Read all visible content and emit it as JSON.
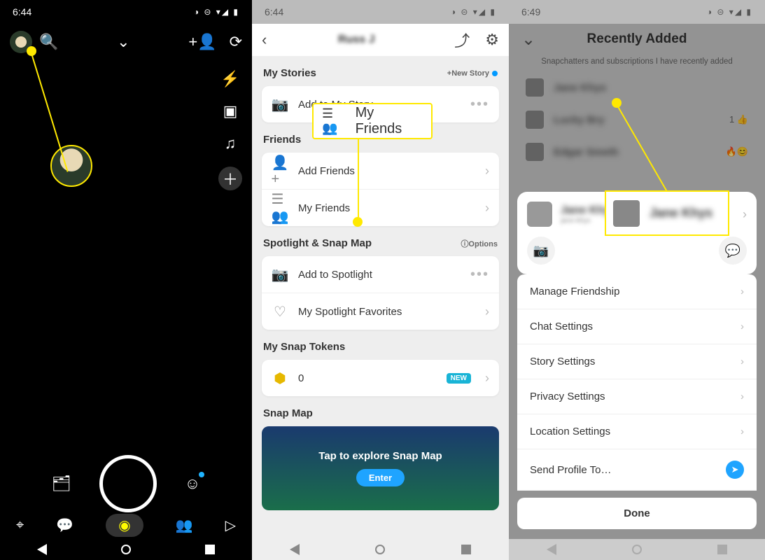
{
  "status": {
    "time1": "6:44",
    "time2": "6:44",
    "time3": "6:49",
    "icons": "◑ ⊝ ▾◢ ▮"
  },
  "p2": {
    "username": "Russ J",
    "sections": {
      "stories": "My Stories",
      "friends": "Friends",
      "spotlight": "Spotlight & Snap Map",
      "tokens": "My Snap Tokens",
      "snapmap": "Snap Map"
    },
    "newStory": "+New Story",
    "options": "ⓘOptions",
    "rows": {
      "addStory": "Add to My Story",
      "addFriends": "Add Friends",
      "myFriends": "My Friends",
      "addSpotlight": "Add to Spotlight",
      "spotFav": "My Spotlight Favorites"
    },
    "tokenCount": "0",
    "newTag": "NEW",
    "map": {
      "tap": "Tap to explore Snap Map",
      "enter": "Enter"
    }
  },
  "callout": "My Friends",
  "p3": {
    "title": "Recently Added",
    "subtitle": "Snapchatters and subscriptions I have recently added",
    "friends": [
      {
        "name": "Jane Khys",
        "meta": ""
      },
      {
        "name": "Lucky Bry",
        "meta": "1 👍"
      },
      {
        "name": "Edgar Smeth",
        "meta": "🔥😊"
      }
    ],
    "popName": "Jane Khys",
    "popSub": "jane-khys",
    "callName": "Jane Khys",
    "rows": [
      "Manage Friendship",
      "Chat Settings",
      "Story Settings",
      "Privacy Settings",
      "Location Settings",
      "Send Profile To…"
    ],
    "done": "Done"
  }
}
